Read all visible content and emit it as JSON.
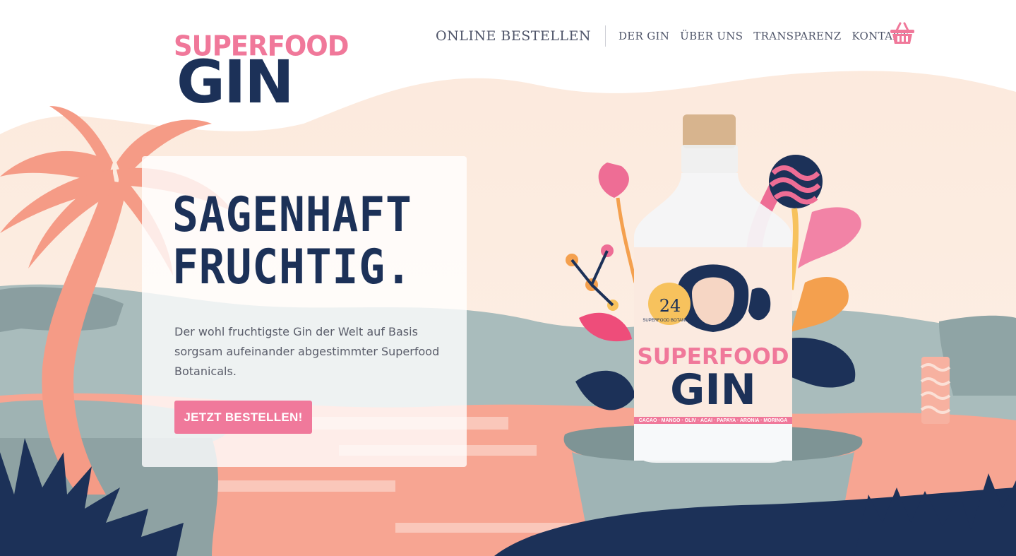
{
  "brand": {
    "top": "SUPERFOOD",
    "main": "GIN"
  },
  "nav": {
    "primary": "ONLINE BESTELLEN",
    "items": [
      "DER GIN",
      "ÜBER UNS",
      "TRANSPARENZ",
      "KONTAKT"
    ]
  },
  "hero": {
    "headline_line1": "SAGENHAFT",
    "headline_line2": "FRUCHTIG.",
    "description": "Der wohl fruchtigste Gin der Welt auf Basis sorgsam aufeinander abgestimmter Superfood Botanicals.",
    "cta": "JETZT BESTELLEN!"
  },
  "bottle": {
    "label_number": "24",
    "label_small": "SUPERFOOD BOTANICALS",
    "label_top": "SUPERFOOD",
    "label_main": "GIN",
    "botanicals": "CACAO · MANGO · OLIV · ACAI · PAPAYA · ARONIA · MORINGA"
  },
  "colors": {
    "navy": "#1c3158",
    "pink": "#f0789a",
    "coral": "#f6a08e",
    "sage": "#9eb0b1",
    "cream": "#fbeee3"
  },
  "icons": {
    "cart": "shopping-basket-icon"
  }
}
